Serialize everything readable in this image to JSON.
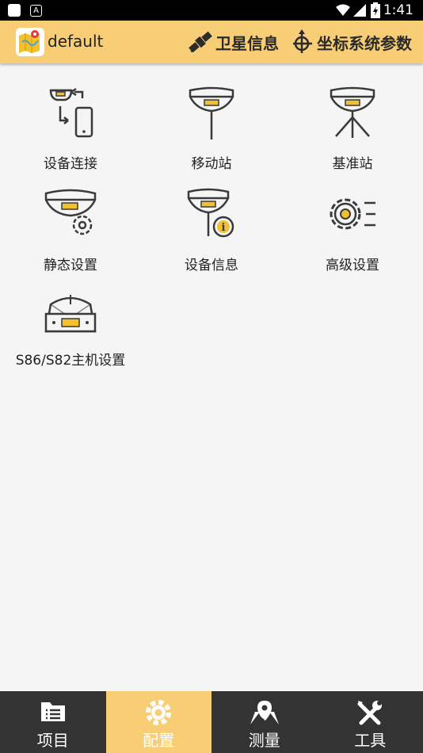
{
  "status_bar": {
    "time": "1:41"
  },
  "app_bar": {
    "title": "default",
    "satellite_info_label": "卫星信息",
    "coordinate_params_label": "坐标系统参数"
  },
  "grid": [
    {
      "label": "设备连接"
    },
    {
      "label": "移动站"
    },
    {
      "label": "基准站"
    },
    {
      "label": "静态设置"
    },
    {
      "label": "设备信息"
    },
    {
      "label": "高级设置"
    },
    {
      "label": "S86/S82主机设置"
    }
  ],
  "bottom_nav": [
    {
      "label": "项目"
    },
    {
      "label": "配置"
    },
    {
      "label": "测量"
    },
    {
      "label": "工具"
    }
  ],
  "colors": {
    "accent": "#f7ce75",
    "receiver_yellow": "#f3c12f",
    "icon_stroke": "#3a3a3a",
    "nav_bg": "#333333"
  }
}
